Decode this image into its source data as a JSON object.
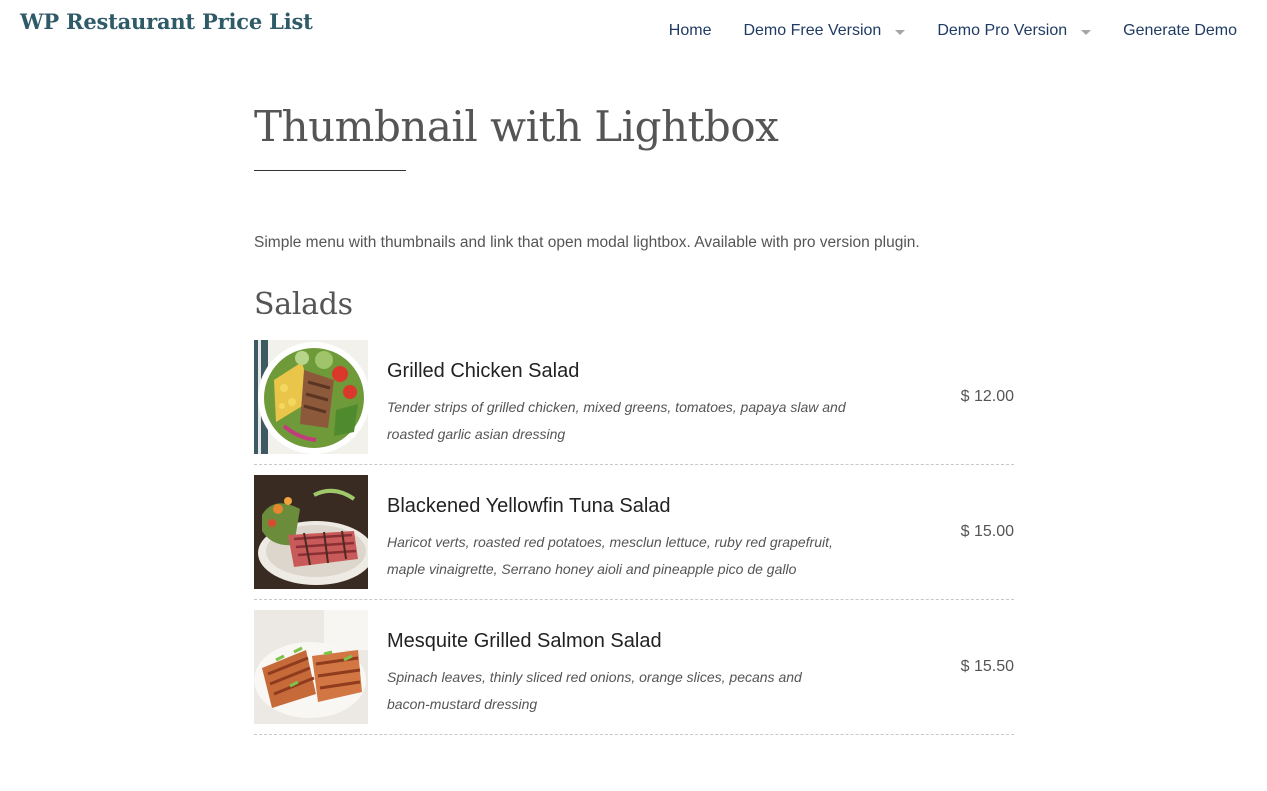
{
  "site": {
    "title": "WP Restaurant Price List"
  },
  "nav": {
    "items": [
      {
        "label": "Home",
        "has_dropdown": false
      },
      {
        "label": "Demo Free Version",
        "has_dropdown": true
      },
      {
        "label": "Demo Pro Version",
        "has_dropdown": true
      },
      {
        "label": "Generate Demo",
        "has_dropdown": false
      }
    ]
  },
  "page": {
    "title": "Thumbnail with Lightbox",
    "intro": "Simple menu with thumbnails and link that open modal lightbox. Available with pro version plugin."
  },
  "section": {
    "title": "Salads",
    "items": [
      {
        "name": "Grilled Chicken Salad",
        "description": "Tender strips of grilled chicken, mixed greens, tomatoes, papaya slaw and roasted garlic asian dressing",
        "price": "$ 12.00",
        "thumbnail_icon": "chicken-salad-photo"
      },
      {
        "name": "Blackened Yellowfin Tuna Salad",
        "description": "Haricot verts, roasted red potatoes, mesclun lettuce, ruby red grapefruit, maple vinaigrette, Serrano honey aioli and pineapple pico de gallo",
        "price": "$ 15.00",
        "thumbnail_icon": "tuna-salad-photo"
      },
      {
        "name": "Mesquite Grilled Salmon Salad",
        "description": "Spinach leaves, thinly sliced red onions, orange slices, pecans and bacon-mustard dressing",
        "price": "$ 15.50",
        "thumbnail_icon": "salmon-salad-photo"
      }
    ]
  },
  "colors": {
    "site_title": "#2f5b69",
    "nav_text": "#1f3b63",
    "heading_text": "#555555",
    "item_name": "#222222",
    "divider": "#c8c8c8"
  }
}
